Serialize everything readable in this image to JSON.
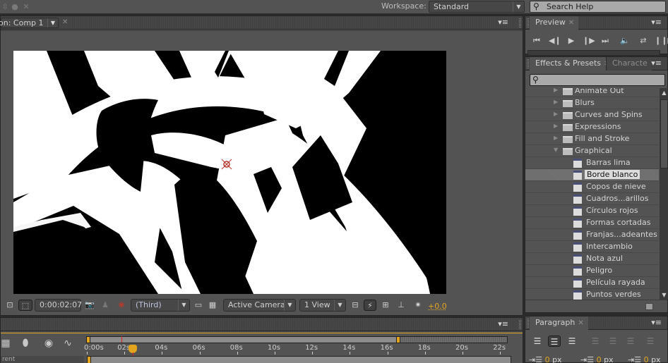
{
  "topbar": {
    "workspace_label": "Workspace:",
    "workspace_value": "Standard",
    "search_placeholder": "Search Help",
    "icons": [
      "snap-icon",
      "mask-feather-icon",
      "puppet-icon"
    ]
  },
  "composition": {
    "tab_label": "on: Comp 1",
    "viewer": {
      "background": "#000000",
      "foreground": "#ffffff",
      "anchor_icon": "anchor-point-icon"
    },
    "toolbar": {
      "timecode": "0:00:02:07",
      "resolution_value": "(Third)",
      "camera_value": "Active Camera",
      "views_value": "1 View",
      "exposure_value": "+0.0"
    }
  },
  "preview": {
    "tab_label": "Preview",
    "controls": [
      "first-frame",
      "previous-frame",
      "play",
      "next-frame",
      "last-frame",
      "audio",
      "loop",
      "ram-preview"
    ]
  },
  "effects": {
    "tab_label": "Effects & Presets",
    "inactive_tab_label": "Characte",
    "search_value": "",
    "items": [
      {
        "type": "folder",
        "label": "Animate Out",
        "expanded": false,
        "depth": 1
      },
      {
        "type": "folder",
        "label": "Blurs",
        "expanded": false,
        "depth": 1
      },
      {
        "type": "folder",
        "label": "Curves and Spins",
        "expanded": false,
        "depth": 1
      },
      {
        "type": "folder",
        "label": "Expressions",
        "expanded": false,
        "depth": 1
      },
      {
        "type": "folder",
        "label": "Fill and Stroke",
        "expanded": false,
        "depth": 1
      },
      {
        "type": "folder",
        "label": "Graphical",
        "expanded": true,
        "depth": 1
      },
      {
        "type": "preset",
        "label": "Barras lima",
        "depth": 2
      },
      {
        "type": "preset",
        "label": "Borde blanco",
        "depth": 2,
        "selected": true
      },
      {
        "type": "preset",
        "label": "Copos de nieve",
        "depth": 2
      },
      {
        "type": "preset",
        "label": "Cuadros...arillos",
        "depth": 2
      },
      {
        "type": "preset",
        "label": "Círculos rojos",
        "depth": 2
      },
      {
        "type": "preset",
        "label": "Formas cortadas",
        "depth": 2
      },
      {
        "type": "preset",
        "label": "Franjas...adeantes",
        "depth": 2
      },
      {
        "type": "preset",
        "label": "Intercambio",
        "depth": 2
      },
      {
        "type": "preset",
        "label": "Nota azul",
        "depth": 2
      },
      {
        "type": "preset",
        "label": "Peligro",
        "depth": 2
      },
      {
        "type": "preset",
        "label": "Película rayada",
        "depth": 2
      },
      {
        "type": "preset",
        "label": "Puntos verdes",
        "depth": 2
      }
    ]
  },
  "paragraph": {
    "tab_label": "Paragraph",
    "alignment_active": "center",
    "indents": [
      {
        "value": "0",
        "unit": "px"
      },
      {
        "value": "0",
        "unit": "px"
      },
      {
        "value": "0",
        "unit": "px"
      }
    ]
  },
  "timeline": {
    "ruler_labels": [
      "0:00s",
      "02s",
      "04s",
      "06s",
      "08s",
      "10s",
      "12s",
      "14s",
      "16s",
      "18s",
      "20s",
      "22s"
    ],
    "current_time_seconds": 2.29,
    "work_area_end_seconds": 16.5,
    "left_row_text": "rent"
  },
  "colors": {
    "accent": "#e3a51d",
    "playhead": "#e01e1e",
    "panel": "#535353",
    "panel_dark": "#464646"
  }
}
